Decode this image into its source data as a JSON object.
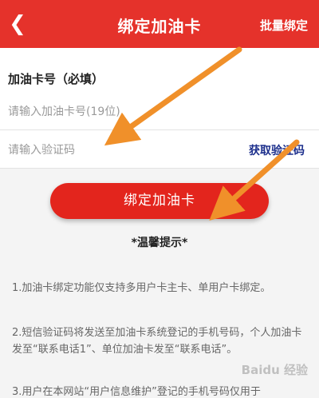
{
  "header": {
    "back_icon": "chevron-left-icon",
    "title": "绑定加油卡",
    "right_action": "批量绑定",
    "color": "#e5322b"
  },
  "form": {
    "card_label": "加油卡号（必填）",
    "card_placeholder": "请输入加油卡号(19位)",
    "code_placeholder": "请输入验证码",
    "get_code_label": "获取验证码"
  },
  "bind_button": {
    "label": "绑定加油卡",
    "color": "#e3251d"
  },
  "tips": {
    "title": "*温馨提示*",
    "items": [
      "1.加油卡绑定功能仅支持多用户卡主卡、单用户卡绑定。",
      "2.短信验证码将发送至加油卡系统登记的手机号码，个人加油卡发至“联系电话1”、单位加油卡发至“联系电话”。",
      "3.用户在本网站“用户信息维护”登记的手机号码仅用于"
    ]
  },
  "watermark": "Baidu 经验",
  "annotation_arrow_color": "#f0902a"
}
